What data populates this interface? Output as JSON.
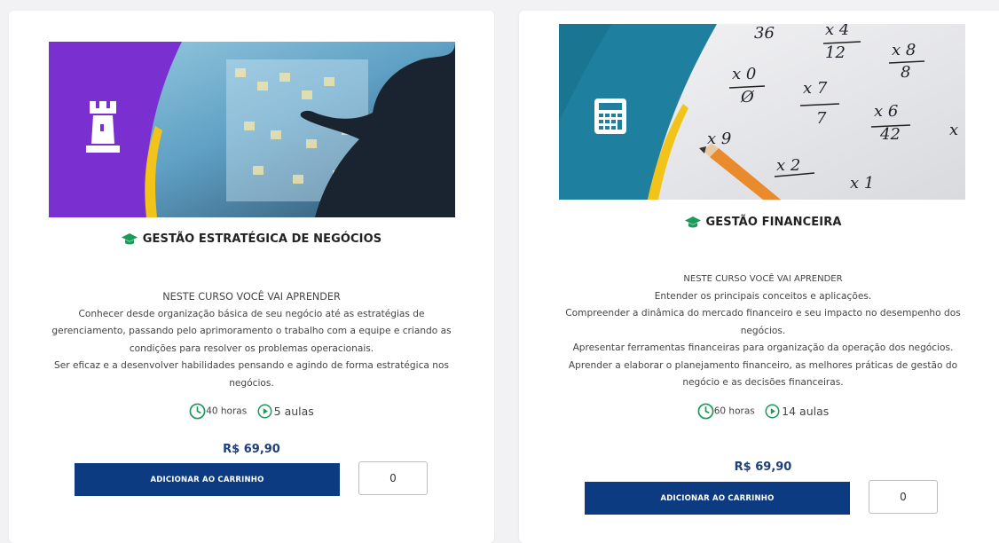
{
  "courses": [
    {
      "title": "GESTÃO ESTRATÉGICA DE NEGÓCIOS",
      "desc_lines": [
        "NESTE CURSO VOCÊ VAI APRENDER",
        "Conhecer desde organização básica de seu negócio até as estratégias de",
        "gerenciamento, passando pelo aprimoramento o trabalho com a equipe e criando as",
        "condições para resolver os problemas operacionais.",
        "Ser eficaz e a desenvolver habilidades pensando e agindo de forma estratégica nos",
        "negócios."
      ],
      "hours": "40 horas",
      "lessons": "5 aulas",
      "price": "R$ 69,90",
      "button_label": "ADICIONAR AO CARRINHO",
      "quantity": "0",
      "banner_icon": "chess-rook-icon",
      "banner_color": "#7a2fd0"
    },
    {
      "title": "GESTÃO FINANCEIRA",
      "desc_lines": [
        "NESTE CURSO VOCÊ VAI APRENDER",
        "Entender os principais conceitos e aplicações.",
        "Compreender a dinâmica do mercado financeiro e seu impacto no desempenho dos",
        "negócios.",
        "Apresentar ferramentas financeiras para organização da operação dos negócios.",
        "Aprender a elaborar o planejamento financeiro, as melhores práticas de gestão do",
        "negócio e as decisões financeiras."
      ],
      "hours": "60 horas",
      "lessons": "14 aulas",
      "price": "R$ 69,90",
      "button_label": "ADICIONAR AO CARRINHO",
      "quantity": "0",
      "banner_icon": "calculator-icon",
      "banner_color": "#1f7f9f"
    }
  ],
  "colors": {
    "accent_green": "#1a9b5a",
    "button_blue": "#0c3b82",
    "price_blue": "#1d3f7a"
  }
}
